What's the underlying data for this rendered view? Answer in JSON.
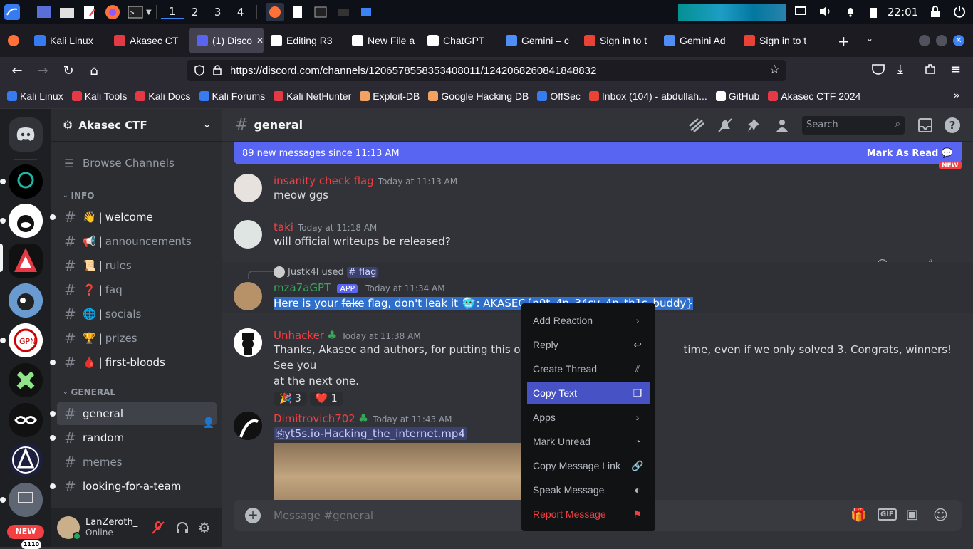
{
  "taskbar": {
    "workspaces": [
      "1",
      "2",
      "3",
      "4"
    ],
    "clock": "22:01"
  },
  "tabs": [
    {
      "label": "Kali Linux",
      "color": "#367bf0"
    },
    {
      "label": "Akasec CT",
      "color": "#e63946"
    },
    {
      "label": "(1) Disco",
      "color": "#5865f2"
    },
    {
      "label": "Editing R3",
      "color": "#ffffff"
    },
    {
      "label": "New File a",
      "color": "#ffffff"
    },
    {
      "label": "ChatGPT",
      "color": "#ffffff"
    },
    {
      "label": "Gemini – c",
      "color": "#4f8ef7"
    },
    {
      "label": "Sign in to t",
      "color": "#ea4335"
    },
    {
      "label": "Gemini Ad",
      "color": "#4f8ef7"
    },
    {
      "label": "Sign in to t",
      "color": "#ea4335"
    }
  ],
  "url": "https://discord.com/channels/1206578558353408011/1242068260841848832",
  "bookmarks": [
    {
      "label": "Kali Linux",
      "color": "#367bf0"
    },
    {
      "label": "Kali Tools",
      "color": "#e63946"
    },
    {
      "label": "Kali Docs",
      "color": "#e63946"
    },
    {
      "label": "Kali Forums",
      "color": "#367bf0"
    },
    {
      "label": "Kali NetHunter",
      "color": "#e63946"
    },
    {
      "label": "Exploit-DB",
      "color": "#f4a261"
    },
    {
      "label": "Google Hacking DB",
      "color": "#f4a261"
    },
    {
      "label": "OffSec",
      "color": "#367bf0"
    },
    {
      "label": "Inbox (104) - abdullah...",
      "color": "#ea4335"
    },
    {
      "label": "GitHub",
      "color": "#ffffff"
    },
    {
      "label": "Akasec CTF 2024",
      "color": "#e63946"
    }
  ],
  "server": {
    "name": "Akasec CTF",
    "browse": "Browse Channels",
    "new_badge": "NEW",
    "new_count": "1110"
  },
  "categories": {
    "info": "INFO",
    "general": "GENERAL"
  },
  "channels_info": [
    {
      "name": "welcome",
      "emoji": "👋",
      "unread": true
    },
    {
      "name": "announcements",
      "emoji": "📢",
      "unread": false
    },
    {
      "name": "rules",
      "emoji": "📜",
      "unread": false
    },
    {
      "name": "faq",
      "emoji": "❓",
      "unread": false
    },
    {
      "name": "socials",
      "emoji": "🌐",
      "unread": false
    },
    {
      "name": "prizes",
      "emoji": "🏆",
      "unread": false
    },
    {
      "name": "first-bloods",
      "emoji": "🩸",
      "unread": true
    }
  ],
  "channels_general": [
    {
      "name": "general",
      "unread": true,
      "selected": true
    },
    {
      "name": "random",
      "unread": true,
      "selected": false
    },
    {
      "name": "memes",
      "unread": false,
      "selected": false
    },
    {
      "name": "looking-for-a-team",
      "unread": true,
      "selected": false
    }
  ],
  "user": {
    "name": "LanZeroth_",
    "status": "Online"
  },
  "chat": {
    "channel": "general",
    "search_placeholder": "Search",
    "new_messages": "89 new messages since 11:13 AM",
    "mark_read": "Mark As Read",
    "new_tag": "NEW",
    "composer_placeholder": "Message #general"
  },
  "messages": [
    {
      "author": "insanity check flag",
      "time": "Today at 11:13 AM",
      "text": "meow ggs",
      "color": "#f23f42"
    },
    {
      "author": "taki",
      "time": "Today at 11:18 AM",
      "text": "will official writeups be released?",
      "color": "#f23f42"
    },
    {
      "reply_user": "Justk4l",
      "reply_used": "used",
      "reply_cmd": "flag",
      "author": "mza7aGPT",
      "app": "APP",
      "time": "Today at 11:34 AM",
      "text_a": "Here is your ",
      "text_strike": "fake",
      "text_b": " flag, don't leak it ",
      "text_c": ": AKASEC{n0t_4n_34sy_4n_th1s_buddy}",
      "color": "#3ba55c"
    },
    {
      "author": "Unhacker",
      "time": "Today at 11:38 AM",
      "text_a": "Thanks, Akasec and authors, for putting this on. My",
      "text_b": "time, even if we only solved 3. Congrats, winners! See you",
      "text_c": "at the next one.",
      "reactions": [
        {
          "emoji": "🎉",
          "count": "3"
        },
        {
          "emoji": "❤️",
          "count": "1"
        }
      ],
      "color": "#f23f42"
    },
    {
      "author": "Dimitrovich702",
      "time": "Today at 11:43 AM",
      "attachment": "yt5s.io-Hacking_the_internet.mp4",
      "color": "#f23f42"
    }
  ],
  "context_menu": [
    {
      "label": "Add Reaction",
      "icon": "chevron-right-icon"
    },
    {
      "label": "Reply",
      "icon": "reply-icon"
    },
    {
      "label": "Create Thread",
      "icon": "thread-icon"
    },
    {
      "label": "Copy Text",
      "icon": "copy-icon"
    },
    {
      "label": "Apps",
      "icon": "chevron-right-icon"
    },
    {
      "label": "Mark Unread",
      "icon": "mark-unread-icon"
    },
    {
      "label": "Copy Message Link",
      "icon": "link-icon"
    },
    {
      "label": "Speak Message",
      "icon": "speak-icon"
    },
    {
      "label": "Report Message",
      "icon": "flag-icon"
    }
  ]
}
